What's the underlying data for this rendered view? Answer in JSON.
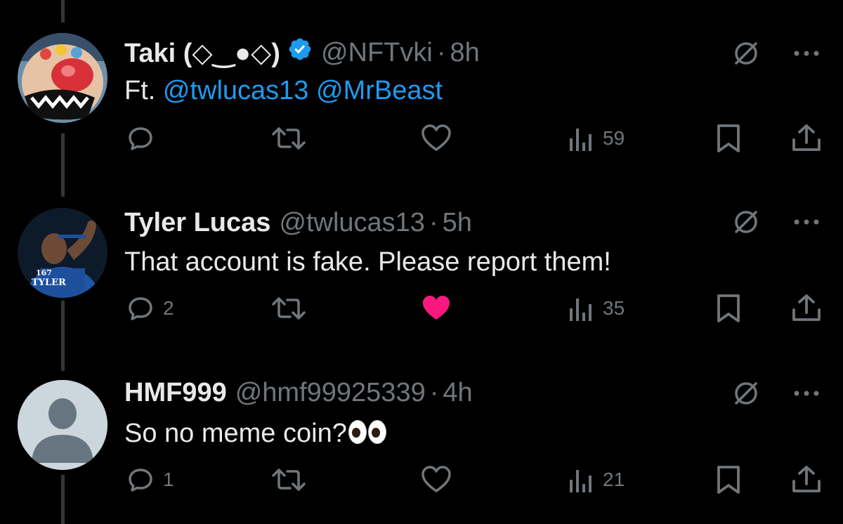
{
  "tweets": [
    {
      "name": "Taki (◇‿●◇)",
      "verified": true,
      "handle": "@NFTvki",
      "time": "8h",
      "text_prefix": "Ft. ",
      "mentions": [
        "@twlucas13",
        "@MrBeast"
      ],
      "actions": {
        "replies": "",
        "views": "59",
        "liked": false
      }
    },
    {
      "name": "Tyler Lucas",
      "verified": false,
      "handle": "@twlucas13",
      "time": "5h",
      "text": "That account is fake. Please report them!",
      "avatar_text": "167\nTYLER",
      "actions": {
        "replies": "2",
        "views": "35",
        "liked": true
      }
    },
    {
      "name": "HMF999",
      "verified": false,
      "handle": "@hmf99925339",
      "time": "4h",
      "text": "So no meme coin?",
      "actions": {
        "replies": "1",
        "views": "21",
        "liked": false
      }
    }
  ],
  "separator": "·",
  "colors": {
    "background": "#000000",
    "text": "#e7e9ea",
    "muted": "#71767b",
    "link": "#1d9bf0",
    "like_active": "#f91880",
    "verified": "#1d9bf0"
  },
  "icons": [
    "reply-icon",
    "retweet-icon",
    "like-icon",
    "views-icon",
    "bookmark-icon",
    "share-icon",
    "grok-icon",
    "more-icon",
    "verified-badge-icon"
  ]
}
